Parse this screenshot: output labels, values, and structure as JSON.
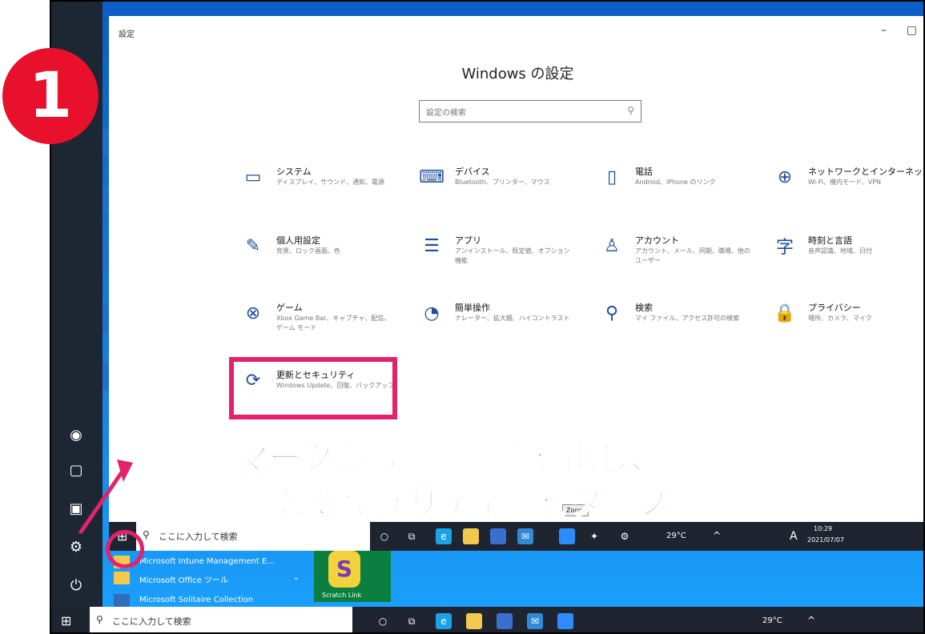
{
  "annotation": {
    "step_number": "1",
    "line1": "歯車マークから設定画面を出し、",
    "line2": "「更新とセキュリティ」をタップ"
  },
  "settings": {
    "window_title": "設定",
    "minimize": "–",
    "restore": "▢",
    "heading": "Windows の設定",
    "search_placeholder": "設定の検索",
    "categories": [
      {
        "title": "システム",
        "desc": "ディスプレイ、サウンド、通知、電源",
        "icon": "laptop-icon",
        "glyph": "▭"
      },
      {
        "title": "デバイス",
        "desc": "Bluetooth、プリンター、マウス",
        "icon": "keyboard-icon",
        "glyph": "⌨"
      },
      {
        "title": "電話",
        "desc": "Android、iPhone のリンク",
        "icon": "phone-icon",
        "glyph": "▯"
      },
      {
        "title": "ネットワークとインターネット",
        "desc": "Wi-Fi、機内モード、VPN",
        "icon": "globe-icon",
        "glyph": "⊕"
      },
      {
        "title": "個人用設定",
        "desc": "背景、ロック画面、色",
        "icon": "paintbrush-icon",
        "glyph": "✎"
      },
      {
        "title": "アプリ",
        "desc": "アンインストール、既定値、オプション機能",
        "icon": "apps-list-icon",
        "glyph": "☰"
      },
      {
        "title": "アカウント",
        "desc": "アカウント、メール、同期、職場、他のユーザー",
        "icon": "person-icon",
        "glyph": "♙"
      },
      {
        "title": "時刻と言語",
        "desc": "音声認識、地域、日付",
        "icon": "language-icon",
        "glyph": "字"
      },
      {
        "title": "ゲーム",
        "desc": "Xbox Game Bar、キャプチャ、配信、ゲーム モード",
        "icon": "xbox-icon",
        "glyph": "⊗"
      },
      {
        "title": "簡単操作",
        "desc": "ナレーター、拡大鏡、ハイコントラスト",
        "icon": "ease-of-access-icon",
        "glyph": "◔"
      },
      {
        "title": "検索",
        "desc": "マイ ファイル、アクセス許可の検索",
        "icon": "search-icon",
        "glyph": "⚲"
      },
      {
        "title": "プライバシー",
        "desc": "場所、カメラ、マイク",
        "icon": "lock-icon",
        "glyph": "🔒"
      },
      {
        "title": "更新とセキュリティ",
        "desc": "Windows Update、回復、バックアップ",
        "icon": "refresh-icon",
        "glyph": "⟳"
      }
    ]
  },
  "inner_taskbar": {
    "search_placeholder": "ここに入力して検索",
    "temperature": "29°C",
    "time": "10:29",
    "date": "2021/07/07",
    "ime": "A",
    "tooltip": "Zoom"
  },
  "start_menu": {
    "item_intune": "Microsoft Intune Management E...",
    "item_office": "Microsoft Office ツール",
    "item_solitaire": "Microsoft Solitaire Collection",
    "scratch_tile_label": "Scratch Link"
  },
  "outer_taskbar": {
    "search_placeholder": "ここに入力して検索",
    "temperature": "29°C"
  },
  "colors": {
    "annotation_pink": "#e3226b",
    "step_badge_red": "#e8102a",
    "settings_icon_blue": "#1f4e9a",
    "taskbar": "#1e2530"
  }
}
